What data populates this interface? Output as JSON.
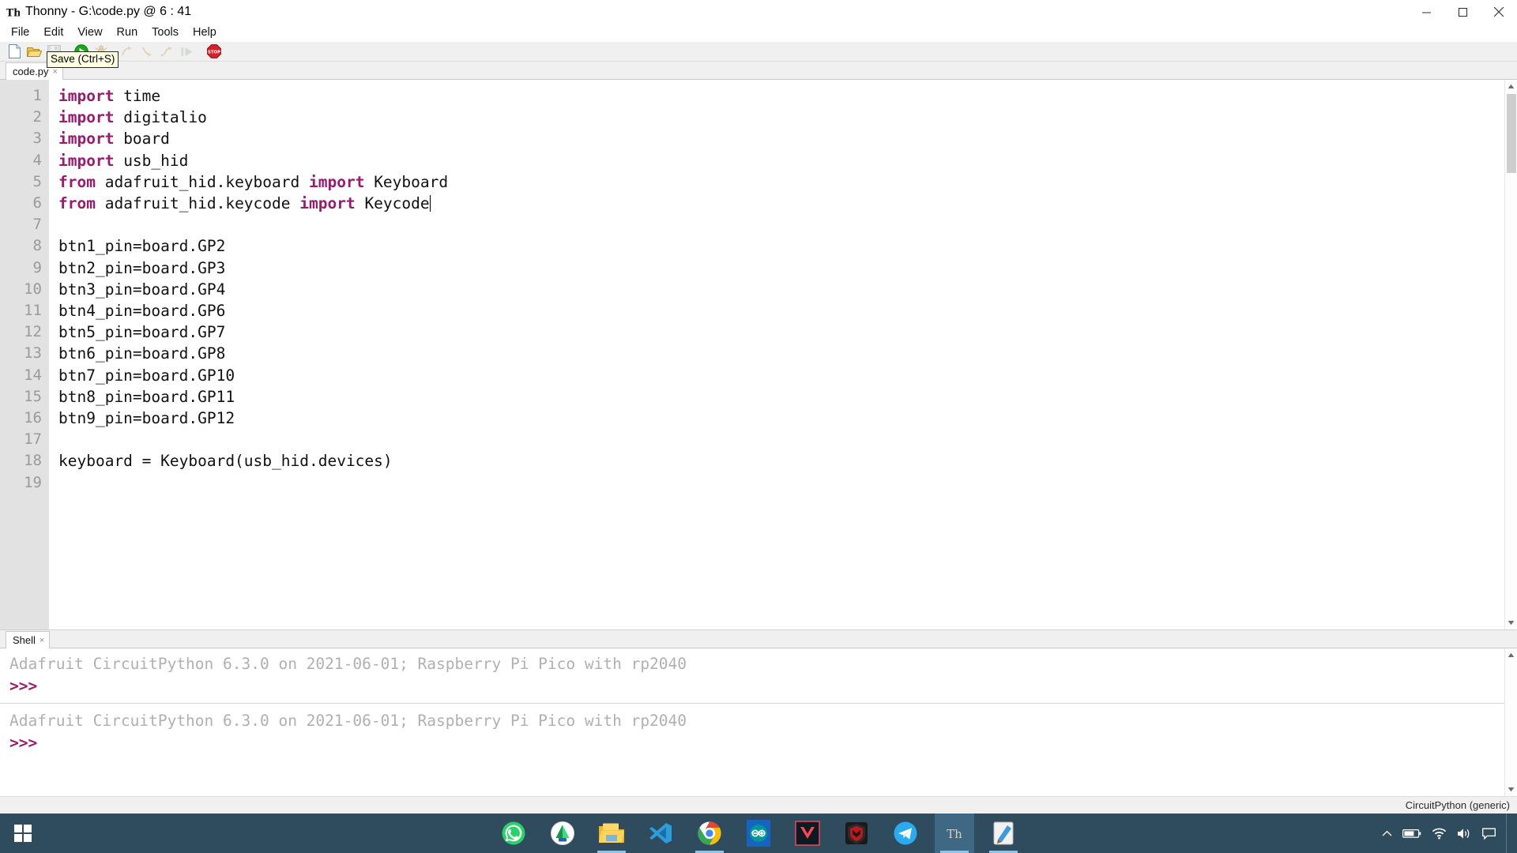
{
  "window": {
    "title": "Thonny  -  G:\\code.py  @  6 : 41",
    "logo_name": "thonny-logo-icon",
    "minimize_label": "Minimize",
    "maximize_label": "Maximize",
    "close_label": "Close"
  },
  "menu": {
    "items": [
      {
        "label": "File",
        "name": "menu-file"
      },
      {
        "label": "Edit",
        "name": "menu-edit"
      },
      {
        "label": "View",
        "name": "menu-view"
      },
      {
        "label": "Run",
        "name": "menu-run"
      },
      {
        "label": "Tools",
        "name": "menu-tools"
      },
      {
        "label": "Help",
        "name": "menu-help"
      }
    ]
  },
  "toolbar": {
    "tooltip": "Save (Ctrl+S)",
    "buttons": [
      {
        "icon": "new-file-icon",
        "label": "New",
        "enabled": true
      },
      {
        "icon": "open-folder-icon",
        "label": "Open",
        "enabled": true
      },
      {
        "icon": "save-disk-icon",
        "label": "Save",
        "enabled": false
      },
      {
        "icon": "run-play-icon",
        "label": "Run",
        "enabled": true
      },
      {
        "icon": "debug-bug-icon",
        "label": "Debug",
        "enabled": false
      },
      {
        "icon": "step-over-icon",
        "label": "Step over",
        "enabled": false
      },
      {
        "icon": "step-into-icon",
        "label": "Step into",
        "enabled": false
      },
      {
        "icon": "step-out-icon",
        "label": "Step out",
        "enabled": false
      },
      {
        "icon": "resume-icon",
        "label": "Resume",
        "enabled": false
      },
      {
        "icon": "stop-sign-icon",
        "label": "Stop",
        "enabled": true
      }
    ]
  },
  "editor": {
    "tab": {
      "label": "code.py",
      "close_glyph": "×"
    },
    "line_numbers": [
      "1",
      "2",
      "3",
      "4",
      "5",
      "6",
      "7",
      "8",
      "9",
      "10",
      "11",
      "12",
      "13",
      "14",
      "15",
      "16",
      "17",
      "18",
      "19"
    ],
    "lines": [
      {
        "n": 1,
        "tokens": [
          {
            "t": "import",
            "k": true
          },
          {
            "t": " time"
          }
        ]
      },
      {
        "n": 2,
        "tokens": [
          {
            "t": "import",
            "k": true
          },
          {
            "t": " digitalio"
          }
        ]
      },
      {
        "n": 3,
        "tokens": [
          {
            "t": "import",
            "k": true
          },
          {
            "t": " board"
          }
        ]
      },
      {
        "n": 4,
        "tokens": [
          {
            "t": "import",
            "k": true
          },
          {
            "t": " usb_hid"
          }
        ]
      },
      {
        "n": 5,
        "tokens": [
          {
            "t": "from",
            "k": true
          },
          {
            "t": " adafruit_hid.keyboard "
          },
          {
            "t": "import",
            "k": true
          },
          {
            "t": " Keyboard"
          }
        ]
      },
      {
        "n": 6,
        "tokens": [
          {
            "t": "from",
            "k": true
          },
          {
            "t": " adafruit_hid.keycode "
          },
          {
            "t": "import",
            "k": true
          },
          {
            "t": " Keycode"
          }
        ],
        "cursor": true
      },
      {
        "n": 7,
        "tokens": [
          {
            "t": ""
          }
        ]
      },
      {
        "n": 8,
        "tokens": [
          {
            "t": "btn1_pin=board.GP2"
          }
        ]
      },
      {
        "n": 9,
        "tokens": [
          {
            "t": "btn2_pin=board.GP3"
          }
        ]
      },
      {
        "n": 10,
        "tokens": [
          {
            "t": "btn3_pin=board.GP4"
          }
        ]
      },
      {
        "n": 11,
        "tokens": [
          {
            "t": "btn4_pin=board.GP6"
          }
        ]
      },
      {
        "n": 12,
        "tokens": [
          {
            "t": "btn5_pin=board.GP7"
          }
        ]
      },
      {
        "n": 13,
        "tokens": [
          {
            "t": "btn6_pin=board.GP8"
          }
        ]
      },
      {
        "n": 14,
        "tokens": [
          {
            "t": "btn7_pin=board.GP10"
          }
        ]
      },
      {
        "n": 15,
        "tokens": [
          {
            "t": "btn8_pin=board.GP11"
          }
        ]
      },
      {
        "n": 16,
        "tokens": [
          {
            "t": "btn9_pin=board.GP12"
          }
        ]
      },
      {
        "n": 17,
        "tokens": [
          {
            "t": ""
          }
        ]
      },
      {
        "n": 18,
        "tokens": [
          {
            "t": "keyboard = Keyboard(usb_hid.devices)"
          }
        ]
      },
      {
        "n": 19,
        "tokens": [
          {
            "t": ""
          }
        ]
      }
    ]
  },
  "shell": {
    "tab": {
      "label": "Shell",
      "close_glyph": "×"
    },
    "entries": [
      {
        "banner": "Adafruit CircuitPython 6.3.0 on 2021-06-01; Raspberry Pi Pico with rp2040",
        "prompt": ">>>"
      },
      {
        "banner": "Adafruit CircuitPython 6.3.0 on 2021-06-01; Raspberry Pi Pico with rp2040",
        "prompt": ">>>"
      }
    ]
  },
  "status_bar": {
    "interpreter": "CircuitPython (generic)"
  },
  "taskbar": {
    "start": {
      "name": "start-button",
      "label": "Start"
    },
    "apps": [
      {
        "name": "taskbar-whatsapp",
        "label": "WhatsApp",
        "running": false
      },
      {
        "name": "taskbar-android-studio",
        "label": "Android Studio",
        "running": false
      },
      {
        "name": "taskbar-file-explorer",
        "label": "File Explorer",
        "running": true
      },
      {
        "name": "taskbar-vscode",
        "label": "Visual Studio Code",
        "running": false
      },
      {
        "name": "taskbar-chrome",
        "label": "Google Chrome",
        "running": true
      },
      {
        "name": "taskbar-arduino",
        "label": "Arduino IDE",
        "running": false
      },
      {
        "name": "taskbar-valorant",
        "label": "Valorant",
        "running": false
      },
      {
        "name": "taskbar-predator",
        "label": "PredatorSense",
        "running": false
      },
      {
        "name": "taskbar-telegram",
        "label": "Telegram",
        "running": false
      },
      {
        "name": "taskbar-thonny",
        "label": "Thonny",
        "running": true,
        "active": true
      },
      {
        "name": "taskbar-paint",
        "label": "Paint",
        "running": true
      }
    ],
    "tray": [
      {
        "name": "show-hidden-icons",
        "glyph": "∧",
        "label": "Show hidden icons"
      },
      {
        "name": "battery-icon",
        "glyph": "battery",
        "label": "Battery"
      },
      {
        "name": "wifi-icon",
        "glyph": "wifi",
        "label": "Network"
      },
      {
        "name": "volume-icon",
        "glyph": "volume",
        "label": "Volume"
      },
      {
        "name": "action-center-icon",
        "glyph": "chat",
        "label": "Action Center"
      }
    ]
  },
  "colors": {
    "keyword": "#9c1a6e",
    "gutter_bg": "#e2e2e2",
    "toolbar_bg": "#f0f0f0",
    "taskbar_bg": "#2e4c5e",
    "taskbar_active": "#3e6883",
    "shell_banner": "#b0b0b0",
    "tooltip_bg": "#ffffe1"
  }
}
